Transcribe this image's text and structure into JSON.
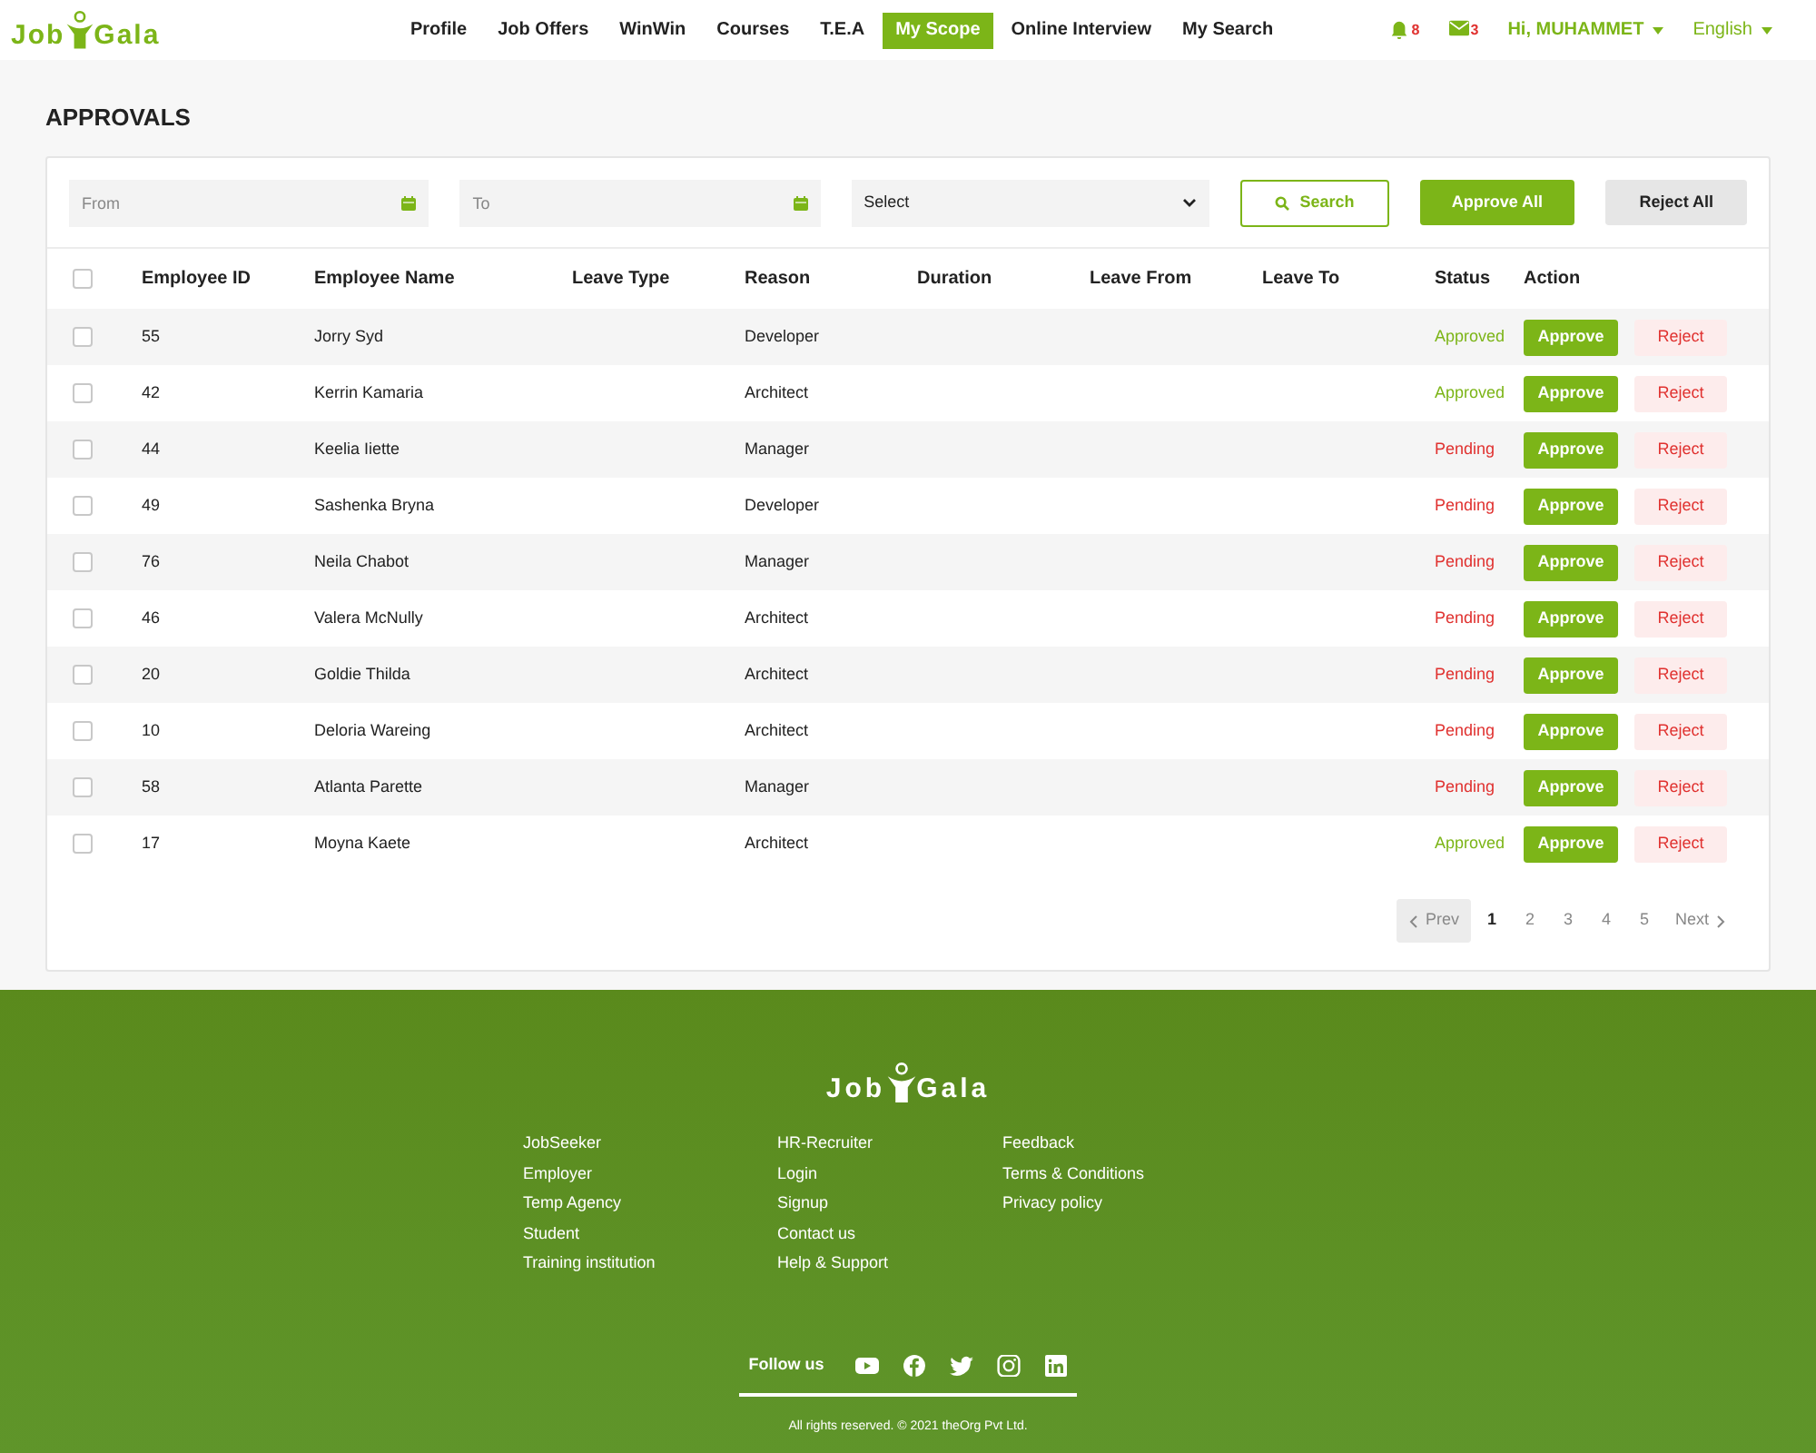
{
  "logo": {
    "left": "Job",
    "right": "Gala"
  },
  "nav": [
    {
      "label": "Profile",
      "selected": false
    },
    {
      "label": "Job Offers",
      "selected": false
    },
    {
      "label": "WinWin",
      "selected": false
    },
    {
      "label": "Courses",
      "selected": false
    },
    {
      "label": "T.E.A",
      "selected": false
    },
    {
      "label": "My Scope",
      "selected": true
    },
    {
      "label": "Online Interview",
      "selected": false
    },
    {
      "label": "My Search",
      "selected": false
    }
  ],
  "notifications": "8",
  "messages": "3",
  "user": "Hi, MUHAMMET",
  "language": "English",
  "page_title": "APPROVALS",
  "filters": {
    "from": {
      "placeholder": "From"
    },
    "to": {
      "placeholder": "To"
    },
    "select": {
      "value": "Select"
    },
    "search": "Search",
    "approve_all": "Approve All",
    "reject_all": "Reject All"
  },
  "table": {
    "header_checked": false,
    "columns": [
      "Employee ID",
      "Employee Name",
      "Leave Type",
      "Reason",
      "Duration",
      "Leave From",
      "Leave To",
      "Status",
      "Action"
    ],
    "rows": [
      {
        "checked": false,
        "id": "55",
        "name": "Jorry Syd",
        "reason": "Developer",
        "status": "Approved",
        "approved": true,
        "approve": "Approve",
        "reject": "Reject"
      },
      {
        "checked": false,
        "id": "42",
        "name": "Kerrin Kamaria",
        "reason": "Architect",
        "status": "Approved",
        "approved": true,
        "approve": "Approve",
        "reject": "Reject"
      },
      {
        "checked": false,
        "id": "44",
        "name": "Keelia Iiette",
        "reason": "Manager",
        "status": "Pending",
        "approved": false,
        "approve": "Approve",
        "reject": "Reject"
      },
      {
        "checked": false,
        "id": "49",
        "name": "Sashenka Bryna",
        "reason": "Developer",
        "status": "Pending",
        "approved": false,
        "approve": "Approve",
        "reject": "Reject"
      },
      {
        "checked": false,
        "id": "76",
        "name": "Neila Chabot",
        "reason": "Manager",
        "status": "Pending",
        "approved": false,
        "approve": "Approve",
        "reject": "Reject"
      },
      {
        "checked": false,
        "id": "46",
        "name": "Valera McNully",
        "reason": "Architect",
        "status": "Pending",
        "approved": false,
        "approve": "Approve",
        "reject": "Reject"
      },
      {
        "checked": false,
        "id": "20",
        "name": "Goldie Thilda",
        "reason": "Architect",
        "status": "Pending",
        "approved": false,
        "approve": "Approve",
        "reject": "Reject"
      },
      {
        "checked": false,
        "id": "10",
        "name": "Deloria Wareing",
        "reason": "Architect",
        "status": "Pending",
        "approved": false,
        "approve": "Approve",
        "reject": "Reject"
      },
      {
        "checked": false,
        "id": "58",
        "name": "Atlanta Parette",
        "reason": "Manager",
        "status": "Pending",
        "approved": false,
        "approve": "Approve",
        "reject": "Reject"
      },
      {
        "checked": false,
        "id": "17",
        "name": "Moyna Kaete",
        "reason": "Architect",
        "status": "Approved",
        "approved": true,
        "approve": "Approve",
        "reject": "Reject"
      }
    ]
  },
  "pagination": {
    "prev": {
      "label": "Prev",
      "disabled": true
    },
    "pages": [
      {
        "label": "1",
        "selected": true
      },
      {
        "label": "2",
        "selected": false
      },
      {
        "label": "3",
        "selected": false
      },
      {
        "label": "4",
        "selected": false
      },
      {
        "label": "5",
        "selected": false
      }
    ],
    "next": {
      "label": "Next",
      "disabled": false
    }
  },
  "footer": {
    "logo": {
      "left": "Job",
      "right": "Gala"
    },
    "columns": [
      [
        "JobSeeker",
        "Employer",
        "Temp Agency",
        "Student",
        "Training institution"
      ],
      [
        "HR-Recruiter",
        "Login",
        "Signup",
        "Contact us",
        "Help & Support"
      ],
      [
        "Feedback",
        "Terms & Conditions",
        "Privacy policy"
      ]
    ],
    "follow_us": "Follow us",
    "copyright": "All rights reserved. © 2021 theOrg Pvt Ltd."
  }
}
